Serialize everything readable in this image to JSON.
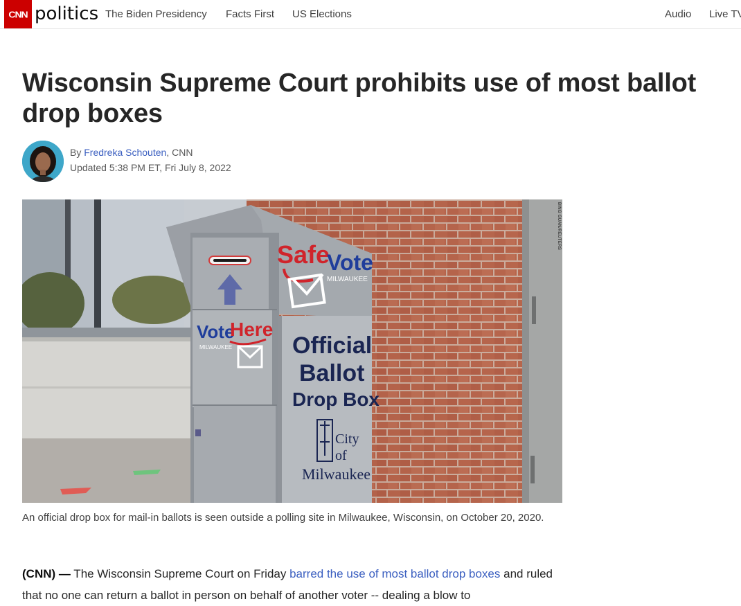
{
  "header": {
    "logo_text": "CNN",
    "section": "politics",
    "nav": [
      "The Biden Presidency",
      "Facts First",
      "US Elections"
    ],
    "nav_right": [
      "Audio",
      "Live TV"
    ]
  },
  "article": {
    "headline": "Wisconsin Supreme Court prohibits use of most ballot drop boxes",
    "byline_prefix": "By ",
    "author": "Fredreka Schouten",
    "outlet": ", CNN",
    "updated": "Updated 5:38 PM ET, Fri July 8, 2022",
    "photo": {
      "credit": "BING GUAN/REUTERS",
      "box_upper_brand_1": "Safe",
      "box_upper_brand_2": "Vote",
      "box_upper_sub": "MILWAUKEE",
      "box_lower_brand_1": "Vote",
      "box_lower_brand_2": "Here",
      "box_lower_sub": "MILWAUKEE",
      "box_sign_line_1": "Official",
      "box_sign_line_2": "Ballot",
      "box_sign_line_3": "Drop Box",
      "city_line_1": "City",
      "city_line_2": "of",
      "city_line_3": "Milwaukee"
    },
    "caption": "An official drop box for mail-in ballots is seen outside a polling site in Milwaukee, Wisconsin, on October 20, 2020.",
    "body": {
      "lead": "(CNN) —",
      "text_1": " The Wisconsin Supreme Court on Friday ",
      "link": "barred the use of most ballot drop boxes",
      "text_2": " and ruled that no one can return a ballot in person on behalf of another voter -- dealing a blow to"
    }
  },
  "colors": {
    "cnn_red": "#cc0000",
    "link_blue": "#3b5fc0",
    "safevote_red": "#d0242b",
    "votehere_blue": "#1f3d9b",
    "sign_navy": "#1a2552"
  }
}
